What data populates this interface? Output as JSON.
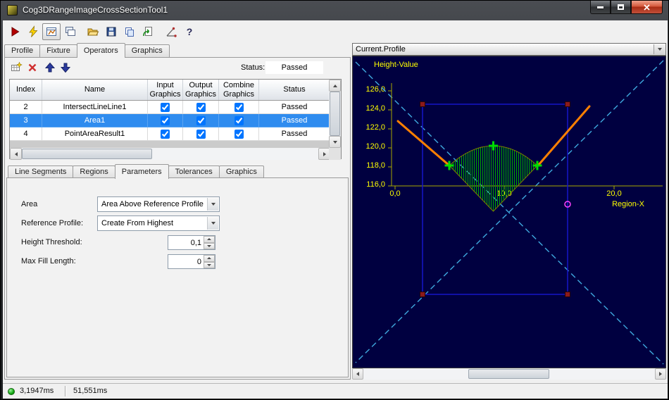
{
  "window": {
    "title": "Cog3DRangeImageCrossSectionTool1",
    "controls": [
      "minimize",
      "maximize",
      "close"
    ]
  },
  "toolbar": {
    "buttons": [
      "run-tool",
      "electric-trigger",
      "profile-display-toggle",
      "copy-window",
      "open-file",
      "save-file",
      "copy-results",
      "import-revert",
      "angle-measure-tool",
      "help"
    ],
    "help_glyph": "?"
  },
  "tabs": {
    "main": [
      {
        "label": "Profile",
        "active": false
      },
      {
        "label": "Fixture",
        "active": false
      },
      {
        "label": "Operators",
        "active": true
      },
      {
        "label": "Graphics",
        "active": false
      }
    ],
    "sub": [
      {
        "label": "Line Segments",
        "active": false
      },
      {
        "label": "Regions",
        "active": false
      },
      {
        "label": "Parameters",
        "active": true
      },
      {
        "label": "Tolerances",
        "active": false
      },
      {
        "label": "Graphics",
        "active": false
      }
    ]
  },
  "operators": {
    "toolbar": [
      "add-operator",
      "delete-operator",
      "move-operator-up",
      "move-operator-down"
    ],
    "status_label": "Status:",
    "status_value": "Passed",
    "columns": [
      "Index",
      "Name",
      "Input Graphics",
      "Output Graphics",
      "Combine Graphics",
      "Status"
    ],
    "rows": [
      {
        "index": "2",
        "name": "IntersectLineLine1",
        "input_graphics": true,
        "output_graphics": true,
        "combine_graphics": true,
        "status": "Passed"
      },
      {
        "index": "3",
        "name": "Area1",
        "input_graphics": true,
        "output_graphics": true,
        "combine_graphics": true,
        "status": "Passed"
      },
      {
        "index": "4",
        "name": "PointAreaResult1",
        "input_graphics": true,
        "output_graphics": true,
        "combine_graphics": true,
        "status": "Passed"
      }
    ],
    "selected_row_index": "3"
  },
  "parameters": {
    "area_label": "Area",
    "area_value": "Area Above Reference Profile",
    "reference_profile_label": "Reference Profile:",
    "reference_profile_value": "Create From Highest",
    "height_threshold_label": "Height Threshold:",
    "height_threshold_value": "0,1",
    "max_fill_length_label": "Max Fill Length:",
    "max_fill_length_value": "0"
  },
  "profile_view": {
    "record_selector": "Current.Profile",
    "chart": {
      "y_axis_label": "Height-Value",
      "x_axis_label": "Region-X",
      "y_ticks": [
        "126,0",
        "124,0",
        "122,0",
        "120,0",
        "118,0",
        "116,0"
      ],
      "x_ticks": [
        "0,0",
        "10,0",
        "20,0"
      ],
      "colors": {
        "background": "#000040",
        "axis": "#a8a800",
        "labels": "#ffff00",
        "profile_line": "#ff8000",
        "area_hatch": "#00a400",
        "markers": "#00de00",
        "region_rect": "#1616c8",
        "corner_handles": "#8b1a1a",
        "diagonal_guides": "#3fa9df",
        "result_point": "#ff40ff"
      }
    }
  },
  "status_bar": {
    "process_time": "3,1947ms",
    "total_time": "51,551ms"
  }
}
